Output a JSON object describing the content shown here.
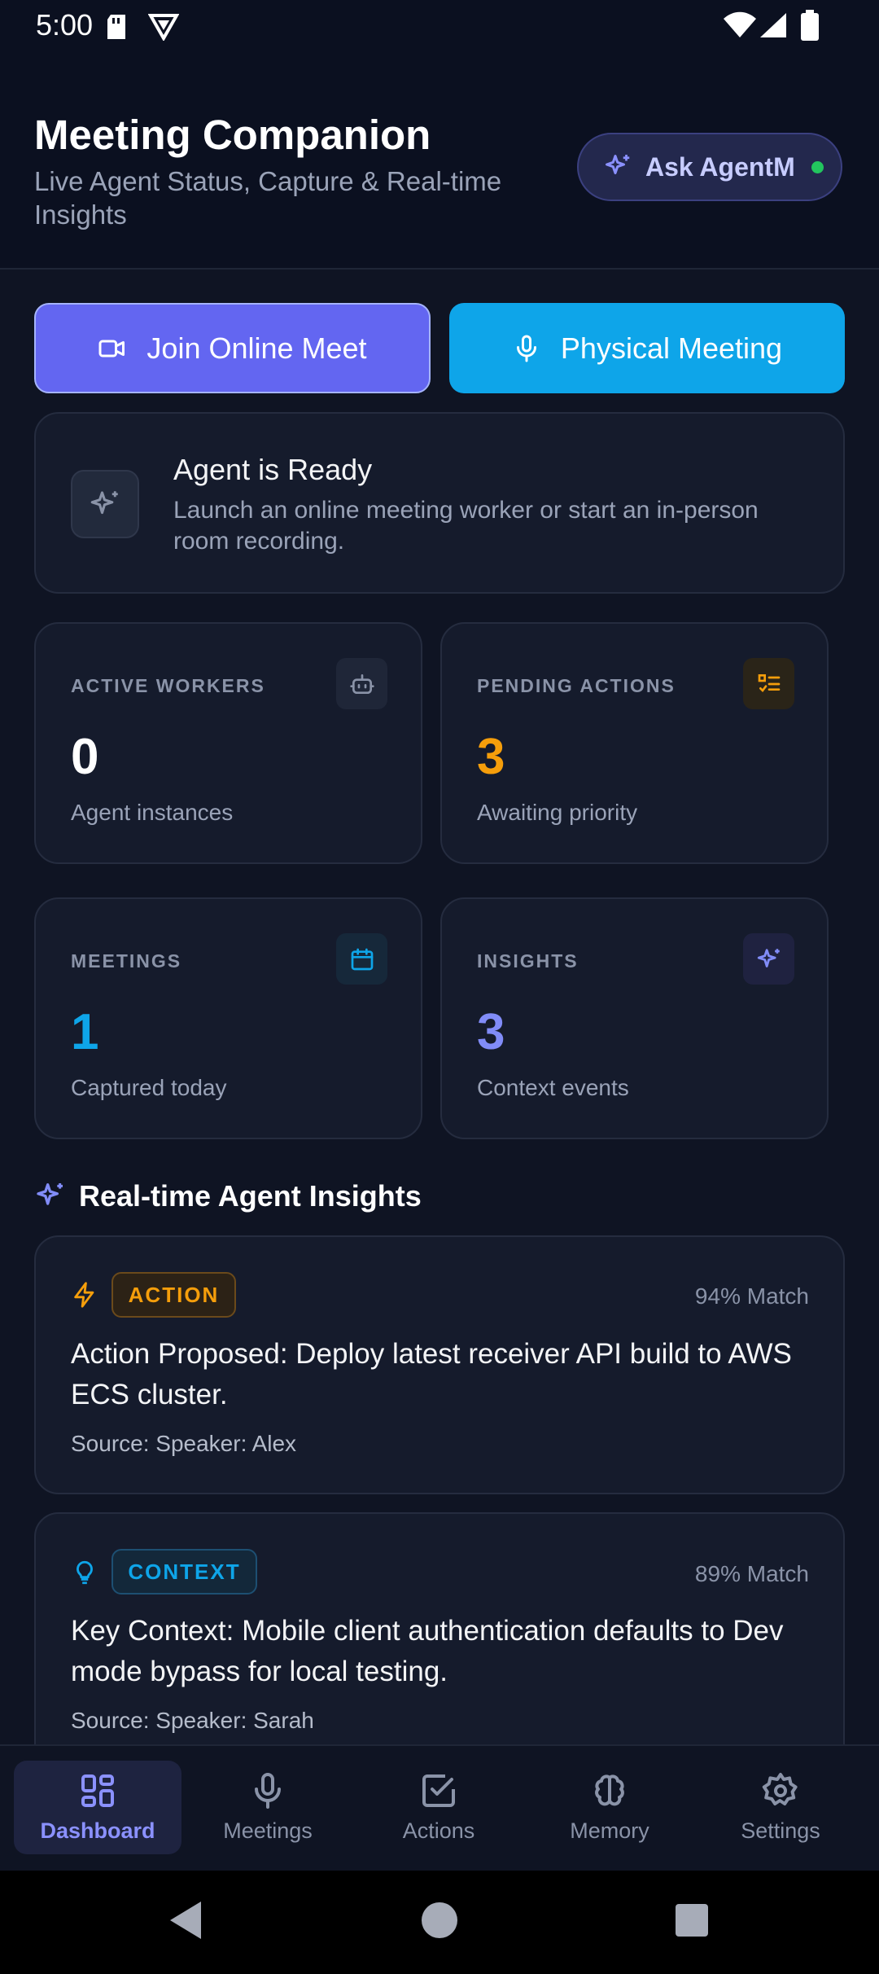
{
  "status_bar": {
    "time": "5:00"
  },
  "header": {
    "title": "Meeting Companion",
    "subtitle": "Live Agent Status, Capture & Real-time Insights",
    "ask_button": "Ask AgentM"
  },
  "actions": {
    "join_online": "Join Online Meet",
    "physical_meeting": "Physical Meeting"
  },
  "ready_card": {
    "title": "Agent is Ready",
    "description": "Launch an online meeting worker or start an in-person room recording."
  },
  "stats": [
    {
      "label": "ACTIVE WORKERS",
      "value": "0",
      "sub": "Agent instances",
      "icon": "robot-icon",
      "color": "#ffffff"
    },
    {
      "label": "PENDING ACTIONS",
      "value": "3",
      "sub": "Awaiting priority",
      "icon": "checklist-icon",
      "color": "#f59e0b"
    },
    {
      "label": "MEETINGS",
      "value": "1",
      "sub": "Captured today",
      "icon": "calendar-icon",
      "color": "#0ea5e9"
    },
    {
      "label": "INSIGHTS",
      "value": "3",
      "sub": "Context events",
      "icon": "sparkle-icon",
      "color": "#818cf8"
    }
  ],
  "insights_section": {
    "title": "Real-time Agent Insights",
    "items": [
      {
        "type": "ACTION",
        "match": "94% Match",
        "text": "Action Proposed: Deploy latest receiver API build to AWS ECS cluster.",
        "source": "Source: Speaker: Alex",
        "icon": "bolt-icon",
        "color": "#f59e0b"
      },
      {
        "type": "CONTEXT",
        "match": "89% Match",
        "text": "Key Context: Mobile client authentication defaults to Dev mode bypass for local testing.",
        "source": "Source: Speaker: Sarah",
        "icon": "lightbulb-icon",
        "color": "#0ea5e9"
      }
    ]
  },
  "bottom_nav": [
    {
      "label": "Dashboard",
      "icon": "dashboard-icon",
      "active": true
    },
    {
      "label": "Meetings",
      "icon": "microphone-icon",
      "active": false
    },
    {
      "label": "Actions",
      "icon": "checkbox-icon",
      "active": false
    },
    {
      "label": "Memory",
      "icon": "brain-icon",
      "active": false
    },
    {
      "label": "Settings",
      "icon": "gear-icon",
      "active": false
    }
  ],
  "colors": {
    "accent": "#6366f1",
    "secondary": "#0ea5e9",
    "warning": "#f59e0b",
    "online": "#22c55e"
  }
}
